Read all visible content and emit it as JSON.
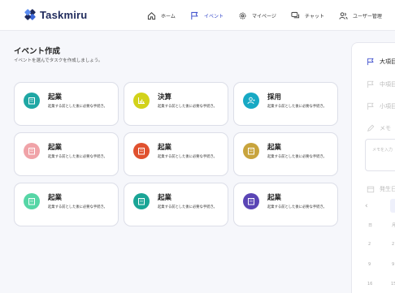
{
  "brand": {
    "name": "Taskmiru"
  },
  "nav": {
    "home": "ホーム",
    "event": "イベント",
    "mypage": "マイページ",
    "chat": "チャット",
    "users": "ユーザー管理"
  },
  "page": {
    "title": "イベント作成",
    "subtitle": "イベントを選んでタスクを作成しましょう。"
  },
  "cards": [
    {
      "title": "起業",
      "desc": "起業する前とした後に必要な手続き。",
      "color": "#1fa7a4",
      "icon": "building-icon"
    },
    {
      "title": "決算",
      "desc": "起業する前とした後に必要な手続き。",
      "color": "#d2d21a",
      "icon": "bar-chart-icon"
    },
    {
      "title": "採用",
      "desc": "起業する前とした後に必要な手続き。",
      "color": "#17a9c4",
      "icon": "person-add-icon"
    },
    {
      "title": "起業",
      "desc": "起業する前とした後に必要な手続き。",
      "color": "#f0a3a8",
      "icon": "building-icon"
    },
    {
      "title": "起業",
      "desc": "起業する前とした後に必要な手続き。",
      "color": "#e0512f",
      "icon": "building-icon"
    },
    {
      "title": "起業",
      "desc": "起業する前とした後に必要な手続き。",
      "color": "#c8a43d",
      "icon": "building-icon"
    },
    {
      "title": "起業",
      "desc": "起業する前とした後に必要な手続き。",
      "color": "#56d6a6",
      "icon": "building-icon"
    },
    {
      "title": "起業",
      "desc": "起業する前とした後に必要な手続き。",
      "color": "#1aa596",
      "icon": "building-icon"
    },
    {
      "title": "起業",
      "desc": "起業する前とした後に必要な手続き。",
      "color": "#5a45b5",
      "icon": "building-icon"
    }
  ],
  "side": {
    "major": "大項目",
    "middle": "中項目",
    "minor": "小項目",
    "memo": "メモ",
    "memo_placeholder": "メモを入力",
    "date": "発生日",
    "prev": "‹",
    "day_mon": "日",
    "day_tue": "月",
    "d1": "2",
    "d2": "9",
    "d3": "16",
    "e1": "2",
    "e2": "9",
    "e3": "15"
  },
  "colors": {
    "accent": "#2b3fc8"
  }
}
